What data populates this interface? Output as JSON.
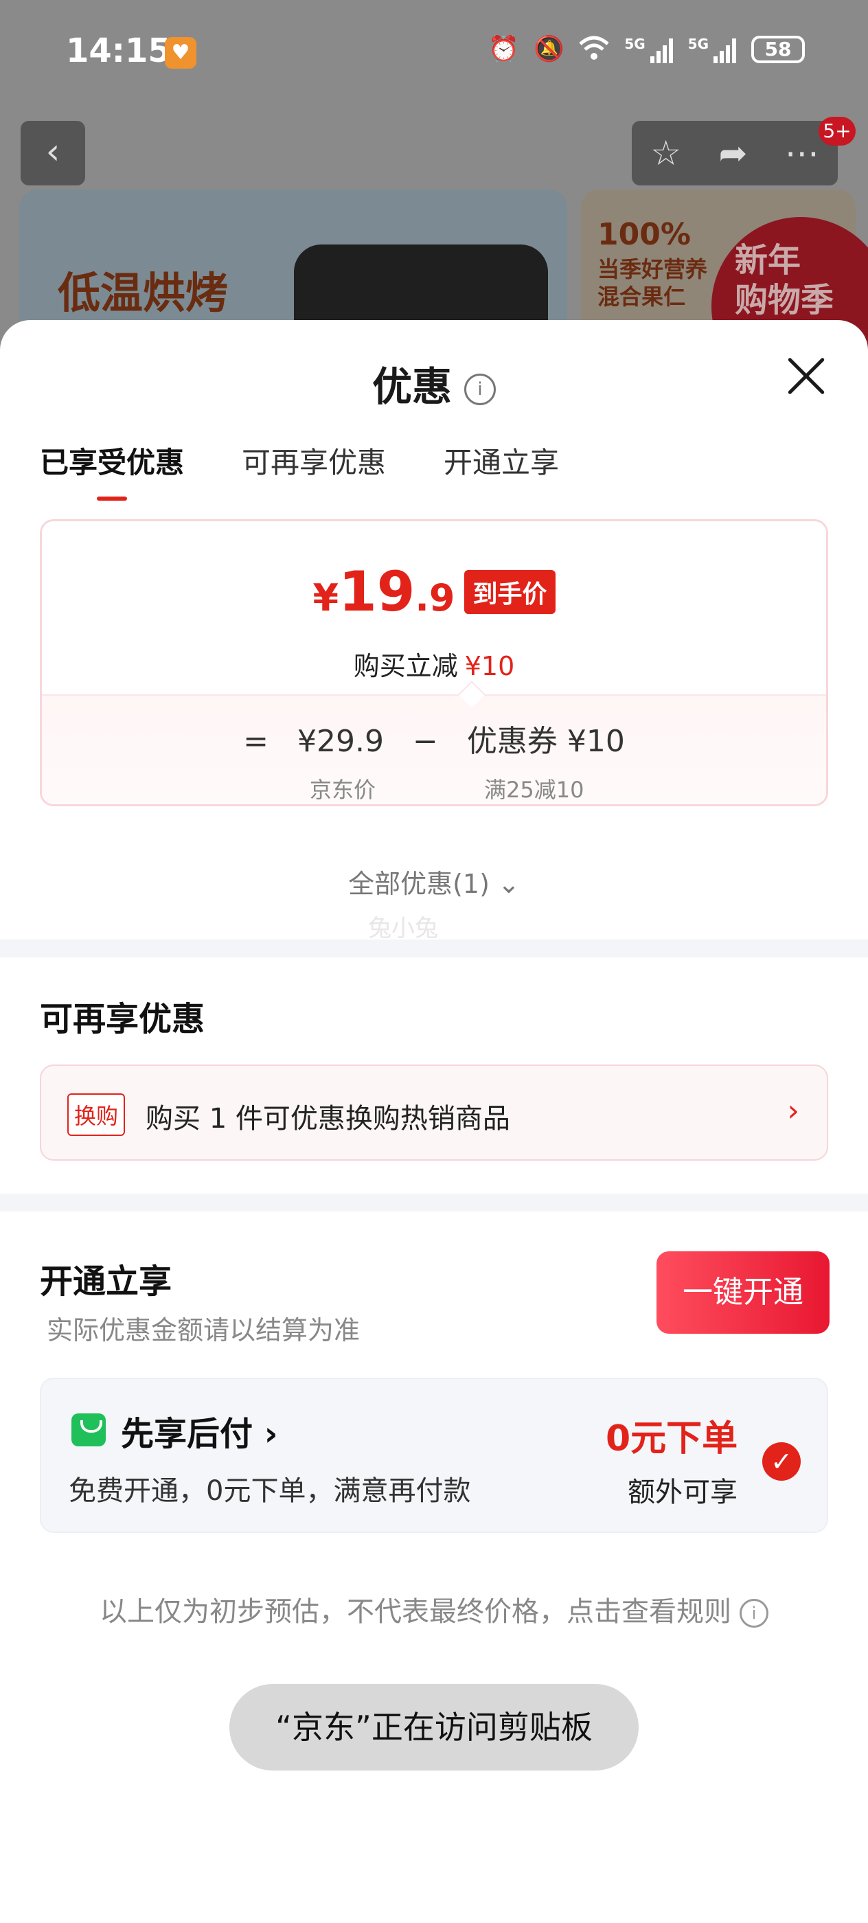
{
  "status_bar": {
    "time": "14:15",
    "app_badge_icon": "heart-app-icon",
    "network_1": "5G",
    "network_2": "5G",
    "battery": "58"
  },
  "background": {
    "notification_count": "5+",
    "banner_left_text": "低温烘烤",
    "banner_right_line1": "100%",
    "banner_right_line2": "当季好营养",
    "banner_right_line3": "混合果仁",
    "promo_line1": "新年",
    "promo_line2": "购物季"
  },
  "sheet": {
    "title": "优惠",
    "tabs": [
      "已享受优惠",
      "可再享优惠",
      "开通立享"
    ],
    "active_tab": 0
  },
  "price_card": {
    "currency": "¥",
    "price_int": "19",
    "price_dec": ".9",
    "price_tag": "到手价",
    "reduce_label": "购买立减",
    "reduce_amount": "¥10",
    "equals": "=",
    "original_price": "¥29.9",
    "minus": "−",
    "coupon_label": "优惠券 ¥10",
    "original_price_label": "京东价",
    "coupon_condition": "满25减10"
  },
  "all_offers": "全部优惠(1)",
  "watermark": "兔小兔",
  "reusable": {
    "title": "可再享优惠",
    "tag": "换购",
    "text": "购买 1 件可优惠换购热销商品"
  },
  "open_now": {
    "title": "开通立享",
    "subtitle": "实际优惠金额请以结算为准",
    "button": "一键开通",
    "pay_title": "先享后付",
    "pay_desc": "免费开通，0元下单，满意再付款",
    "pay_zero": "0元下单",
    "pay_extra": "额外可享"
  },
  "disclaimer": "以上仅为初步预估，不代表最终价格，点击查看规则",
  "toast": "“京东”正在访问剪贴板",
  "colors": {
    "accent_red": "#e2231a",
    "pay_green": "#1fbf5a"
  }
}
